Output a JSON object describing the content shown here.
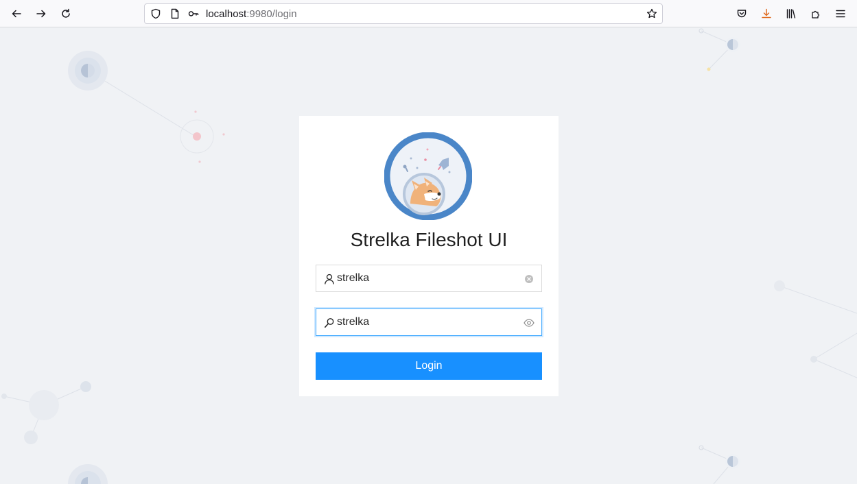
{
  "browser": {
    "url_host": "localhost",
    "url_rest": ":9980/login",
    "icons": [
      "back-icon",
      "forward-icon",
      "reload-icon",
      "shield-icon",
      "page-icon",
      "key-icon",
      "star-icon",
      "pocket-icon",
      "download-icon",
      "library-icon",
      "extensions-icon",
      "menu-icon"
    ]
  },
  "login": {
    "title": "Strelka Fileshot UI",
    "username_value": "strelka",
    "password_value": "strelka",
    "button_label": "Login"
  },
  "colors": {
    "accent": "#1890ff",
    "page_bg": "#f0f2f5",
    "avatar_ring": "#4a86c8"
  }
}
